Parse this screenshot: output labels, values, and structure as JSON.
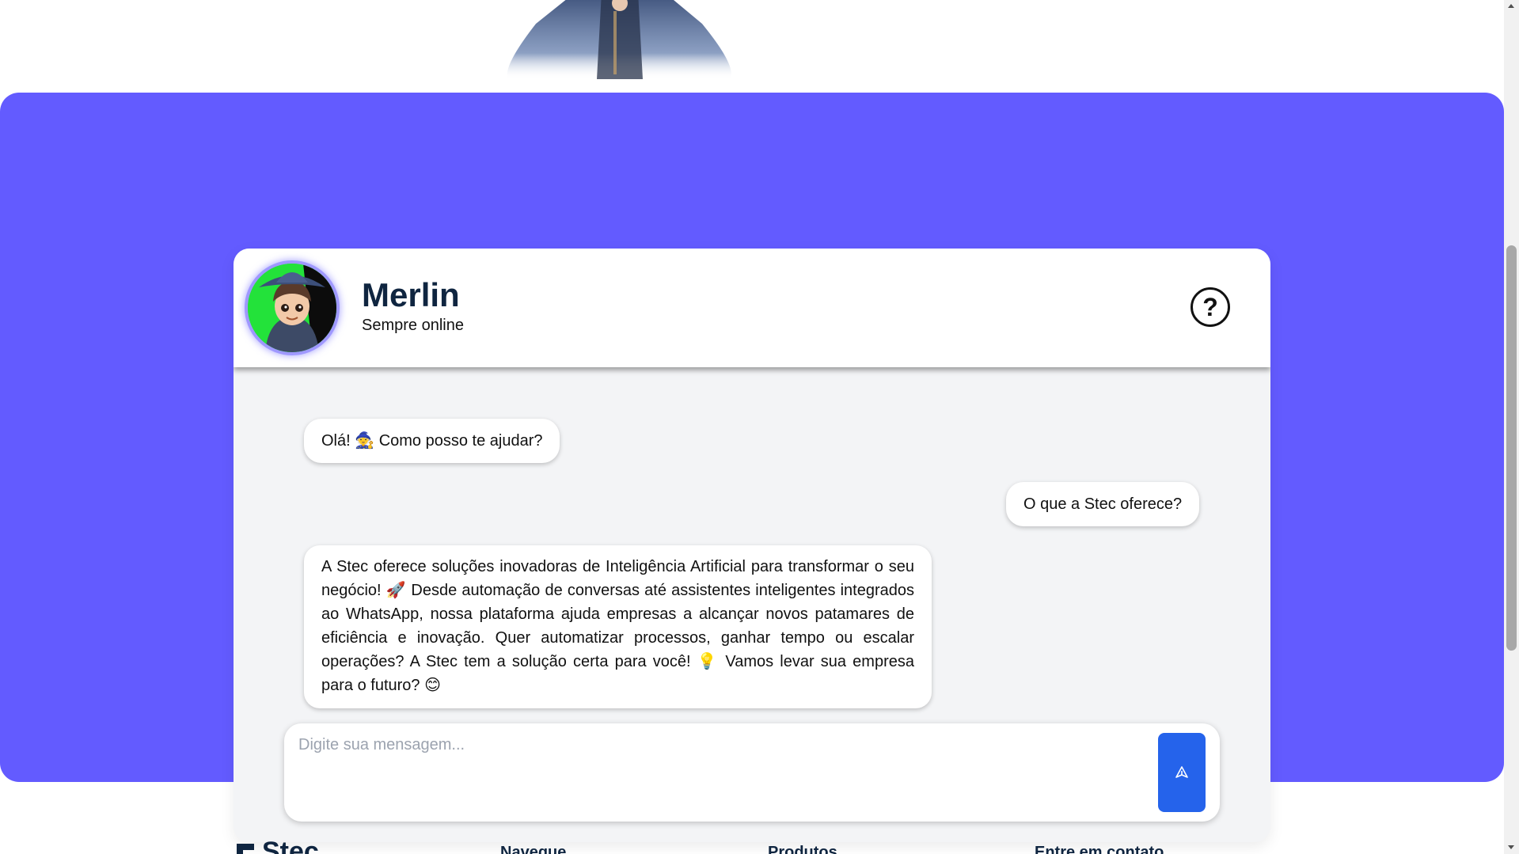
{
  "chat": {
    "bot_name": "Merlin",
    "bot_status": "Sempre online",
    "help_icon": "help-circle-icon",
    "messages": [
      {
        "from": "bot",
        "text": "Olá! 🧙 Como posso te ajudar?"
      },
      {
        "from": "user",
        "text": "O que a Stec oferece?"
      },
      {
        "from": "bot",
        "text": "A Stec oferece soluções inovadoras de Inteligência Artificial para transformar o seu negócio! 🚀 Desde automação de conversas até assistentes inteligentes integrados ao WhatsApp, nossa plataforma ajuda empresas a alcançar novos patamares de eficiência e inovação. Quer automatizar processos, ganhar tempo ou escalar operações? A Stec tem a solução certa para você! 💡 Vamos levar sua empresa para o futuro? 😊"
      }
    ],
    "input": {
      "value": "",
      "placeholder": "Digite sua mensagem..."
    },
    "send_icon": "send-icon"
  },
  "footer": {
    "logo_text": "Stec",
    "headings": [
      "Navegue",
      "Produtos",
      "Entre em contato"
    ]
  },
  "colors": {
    "section_background": "#635bff",
    "send_button": "#2563eb",
    "avatar_background": "#23e23a",
    "heading_text": "#0f2540"
  }
}
